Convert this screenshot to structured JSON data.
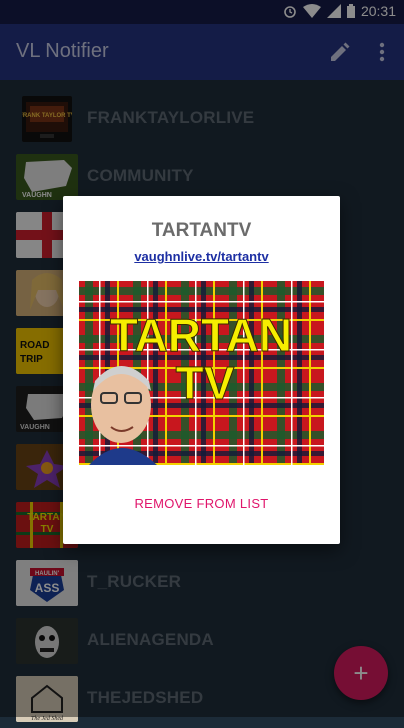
{
  "statusbar": {
    "time": "20:31",
    "icons": [
      "alarm-icon",
      "wifi-icon",
      "signal-icon",
      "battery-icon"
    ]
  },
  "toolbar": {
    "title": "VL Notifier",
    "icons": [
      "edit-icon",
      "more-vert-icon"
    ]
  },
  "list": {
    "items": [
      {
        "label": "FRANKTAYLORLIVE",
        "thumb_text": "FRANK TAYLOR TV"
      },
      {
        "label": "COMMUNITY",
        "thumb_text": "VAUGHN"
      },
      {
        "label": ""
      },
      {
        "label": ""
      },
      {
        "label": "",
        "thumb_text": "ROAD TRIP"
      },
      {
        "label": "",
        "thumb_text": "VAUGHN"
      },
      {
        "label": ""
      },
      {
        "label": "",
        "thumb_text": "TARTAN TV"
      },
      {
        "label": "T_RUCKER",
        "thumb_text": "HAULIN' ASS"
      },
      {
        "label": "ALIENAGENDA"
      },
      {
        "label": "THEJEDSHED",
        "thumb_text": "The Jed Shed"
      }
    ]
  },
  "dialog": {
    "title": "TARTANTV",
    "link": "vaughnlive.tv/tartantv",
    "image_text_line1": "TARTAN",
    "image_text_line2": "TV",
    "remove_label": "REMOVE FROM LIST"
  },
  "fab": {
    "label": "+"
  },
  "colors": {
    "toolbar": "#253381",
    "statusbar": "#171d49",
    "accent": "#d81b60",
    "link": "#1d2fa3"
  }
}
